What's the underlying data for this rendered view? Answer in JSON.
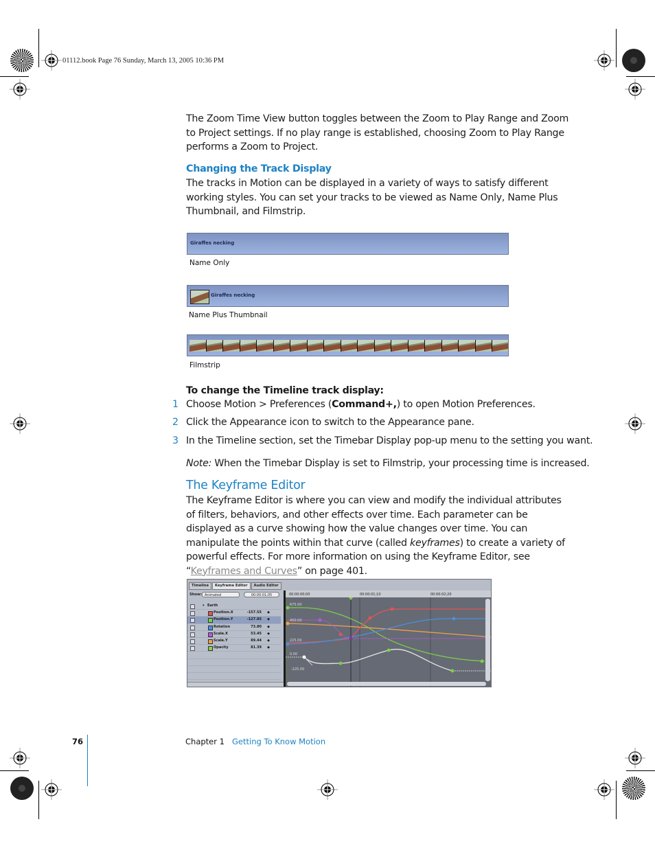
{
  "print_header": "01112.book  Page 76  Sunday, March 13, 2005  10:36 PM",
  "intro_paragraph": "The Zoom Time View button toggles between the Zoom to Play Range and Zoom to Project settings. If no play range is established, choosing Zoom to Play Range performs a Zoom to Project.",
  "section_track_display": {
    "heading": "Changing the Track Display",
    "body": "The tracks in Motion can be displayed in a variety of ways to satisfy different working styles. You can set your tracks to be viewed as Name Only, Name Plus Thumbnail, and Filmstrip.",
    "figures": [
      {
        "track_name": "Giraffes necking",
        "caption": "Name Only"
      },
      {
        "track_name": "Giraffes necking",
        "caption": "Name Plus Thumbnail"
      },
      {
        "track_name": "",
        "caption": "Filmstrip"
      }
    ]
  },
  "procedure": {
    "heading": "To change the Timeline track display:",
    "steps": [
      {
        "num": "1",
        "pre": "Choose Motion > Preferences (",
        "bold": "Command+,",
        "post": ") to open Motion Preferences."
      },
      {
        "num": "2",
        "text": "Click the Appearance icon to switch to the Appearance pane."
      },
      {
        "num": "3",
        "text": "In the Timeline section, set the Timebar Display pop-up menu to the setting you want."
      }
    ],
    "note_label": "Note:",
    "note_text": " When the Timebar Display is set to Filmstrip, your processing time is increased."
  },
  "section_keyframe": {
    "heading": "The Keyframe Editor",
    "body_pre": "The Keyframe Editor is where you can view and modify the individual attributes of filters, behaviors, and other effects over time. Each parameter can be displayed as a curve showing how the value changes over time. You can manipulate the points within that curve (called ",
    "body_italic": "keyframes",
    "body_mid": ") to create a variety of powerful effects. For more information on using the Keyframe Editor, see “",
    "link_text": "Keyframes and Curves",
    "body_post": "” on page 401."
  },
  "keyframe_editor": {
    "tabs": [
      "Timeline",
      "Keyframe Editor",
      "Audio Editor"
    ],
    "active_tab": "Keyframe Editor",
    "show_label": "Show:",
    "show_value": "Animated",
    "timecode": "00:00:01;05",
    "group": "Earth",
    "params": [
      {
        "name": "Position.X",
        "value": "-157.55",
        "color": "#e05555",
        "selected": false
      },
      {
        "name": "Position.Y",
        "value": "-127.85",
        "color": "#7ad04a",
        "selected": true
      },
      {
        "name": "Rotation",
        "value": "73.80",
        "color": "#4a90e0",
        "selected": false
      },
      {
        "name": "Scale.X",
        "value": "53.45",
        "color": "#b35ae0",
        "selected": false
      },
      {
        "name": "Scale.Y",
        "value": "89.44",
        "color": "#f0a050",
        "selected": false
      },
      {
        "name": "Opacity",
        "value": "81.39",
        "color": "#8ad04a",
        "selected": false
      }
    ],
    "ruler_labels": [
      "00:00:00;00",
      "00:00:01;10",
      "00:00:02;20"
    ],
    "value_labels": [
      "675.00",
      "450.00",
      "225.00",
      "0.00",
      "-225.00"
    ]
  },
  "footer": {
    "page_number": "76",
    "chapter": "Chapter 1",
    "chapter_title": "Getting To Know Motion"
  }
}
